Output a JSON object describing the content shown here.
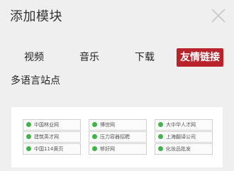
{
  "dialog": {
    "title": "添加模块"
  },
  "tabs": [
    {
      "label": "视频"
    },
    {
      "label": "音乐"
    },
    {
      "label": "下载"
    },
    {
      "label": "友情链接"
    },
    {
      "label": "多语言站点"
    }
  ],
  "active_tab": "友情链接",
  "accent_color": "#b8232b",
  "link_icon_color": "#3eb44a",
  "preview_links": [
    [
      "中国林业网",
      "博世网",
      "大中华人才网"
    ],
    [
      "建筑英才网",
      "压力容器招聘",
      "上海翻译公司"
    ],
    [
      "中国114黄页",
      "够好网",
      "化妆品批发"
    ]
  ]
}
